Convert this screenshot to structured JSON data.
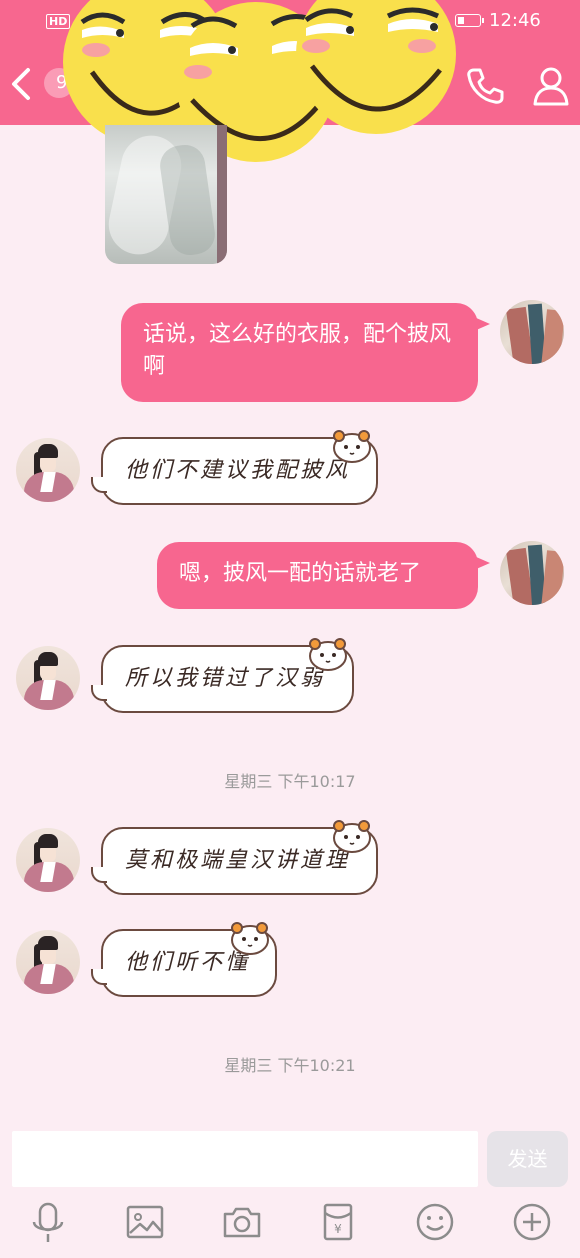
{
  "status_bar": {
    "network_badge": "HD",
    "time": "12:46"
  },
  "header": {
    "unread_count": "9"
  },
  "messages": {
    "self_1": "话说，这么好的衣服，配个披风啊",
    "other_1": "他们不建议我配披风",
    "self_2": "嗯，披风一配的话就老了",
    "other_2": "所以我错过了汉弱",
    "time_1": "星期三 下午10:17",
    "other_3": "莫和极端皇汉讲道理",
    "other_4": "他们听不懂",
    "time_2": "星期三 下午10:21"
  },
  "input": {
    "placeholder": "",
    "send_label": "发送"
  },
  "toolbar": [
    "voice-icon",
    "image-icon",
    "camera-icon",
    "red-packet-icon",
    "emoji-icon",
    "plus-icon"
  ],
  "colors": {
    "accent": "#f7678f",
    "background": "#fcedf3"
  }
}
